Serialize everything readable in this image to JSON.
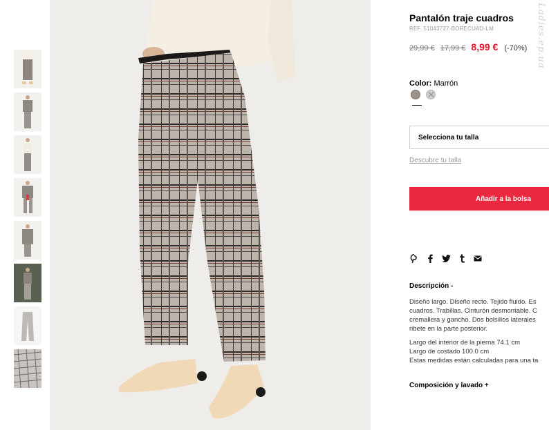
{
  "product": {
    "title": "Pantalón traje cuadros",
    "ref": "REF. 51043727-BORECUAD-LM",
    "price_original": "29,99 €",
    "price_previous": "17,99 €",
    "price_current": "8,99 €",
    "discount": "(-70%)"
  },
  "color": {
    "label": "Color:",
    "value": "Marrón",
    "swatches": [
      "brown-swatch",
      "grey-swatch"
    ]
  },
  "size": {
    "select_label": "Selecciona tu talla",
    "guide_link": "Descubre tu talla"
  },
  "cart": {
    "add_label": "Añadir a la bolsa"
  },
  "share": {
    "icons": [
      "pinterest-icon",
      "facebook-icon",
      "twitter-icon",
      "tumblr-icon",
      "email-icon"
    ]
  },
  "description": {
    "heading": "Descripción -",
    "lines": [
      "Diseño largo. Diseño recto. Tejido fluido. Es",
      "cuadros. Trabillas. Cinturón desmontable. C",
      "cremallera y gancho. Dos bolsillos laterales",
      "ribete en la parte posterior."
    ],
    "measures": [
      "Largo del interior de la pierna 74.1 cm",
      "Largo de costado 100.0 cm",
      "Estas medidas están calculadas para una ta"
    ]
  },
  "composition": {
    "heading": "Composición y lavado +"
  },
  "watermark": "Ladies.ep.ua",
  "colors": {
    "accent_red": "#e8283e",
    "price_red": "#e0162b"
  }
}
